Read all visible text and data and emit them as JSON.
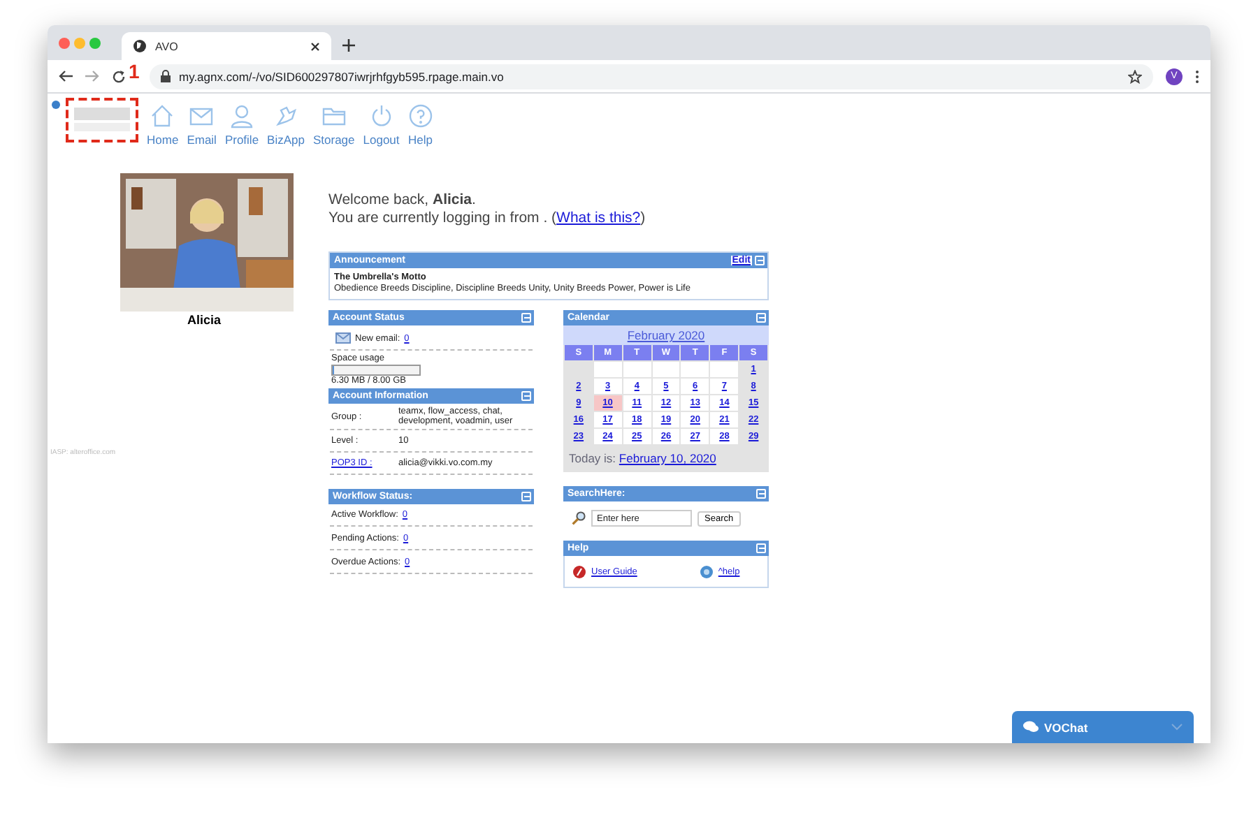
{
  "browser": {
    "tab_title": "AVO",
    "url": "my.agnx.com/-/vo/SID600297807iwrjrhfgyb595.rpage.main.vo",
    "avatar": "V"
  },
  "annotation": {
    "label": "1"
  },
  "nav": [
    {
      "label": "Home",
      "kind": "home"
    },
    {
      "label": "Email",
      "kind": "email"
    },
    {
      "label": "Profile",
      "kind": "profile"
    },
    {
      "label": "BizApp",
      "kind": "bizapp"
    },
    {
      "label": "Storage",
      "kind": "storage"
    },
    {
      "label": "Logout",
      "kind": "logout"
    },
    {
      "label": "Help",
      "kind": "help"
    }
  ],
  "profile": {
    "name": "Alicia"
  },
  "footer_note": "IASP: alteroffice.com",
  "welcome": {
    "greeting": "Welcome back, **Alicia**.",
    "login_line": "You are currently logging in from . (",
    "link": "What is this?",
    "after": ")"
  },
  "announcement": {
    "title": "Announcement",
    "edit": "Edit",
    "heading": "The Umbrella's Motto",
    "body": "Obedience Breeds Discipline, Discipline Breeds Unity, Unity Breeds Power, Power is Life"
  },
  "account_status": {
    "title": "Account Status",
    "new_email_label": "New email:",
    "new_email": "0",
    "space_label": "Space usage",
    "space": {
      "level": 0.01
    },
    "space_text": "6.30 MB / 8.00 GB"
  },
  "account_info": {
    "title": "Account Information",
    "rows": [
      {
        "label": "Group :",
        "value": "teamx, flow_access, chat, development, voadmin, user",
        "kind": "text"
      },
      {
        "label": "Level :",
        "value": "10",
        "kind": "text"
      },
      {
        "label": "POP3 ID :",
        "value": "alicia@vikki.vo.com.my",
        "kind": "link"
      }
    ]
  },
  "workflow": {
    "title": "Workflow Status:",
    "rows": [
      {
        "label": "Active Workflow:",
        "value": "0"
      },
      {
        "label": "Pending Actions:",
        "value": "0"
      },
      {
        "label": "Overdue Actions:",
        "value": "0"
      }
    ]
  },
  "calendar": {
    "title": "Calendar",
    "month": "February 2020",
    "weekdays": [
      "S",
      "M",
      "T",
      "W",
      "T",
      "F",
      "S"
    ],
    "weeks": [
      [
        {
          "kind": "blank"
        },
        {
          "kind": "blank"
        },
        {
          "kind": "blank"
        },
        {
          "kind": "blank"
        },
        {
          "kind": "blank"
        },
        {
          "kind": "blank"
        },
        {
          "kind": "day",
          "day": "1",
          "selected": false
        }
      ],
      [
        {
          "kind": "day",
          "day": "2",
          "selected": false
        },
        {
          "kind": "day",
          "day": "3",
          "selected": false
        },
        {
          "kind": "day",
          "day": "4",
          "selected": false
        },
        {
          "kind": "day",
          "day": "5",
          "selected": false
        },
        {
          "kind": "day",
          "day": "6",
          "selected": false
        },
        {
          "kind": "day",
          "day": "7",
          "selected": false
        },
        {
          "kind": "day",
          "day": "8",
          "selected": false
        }
      ],
      [
        {
          "kind": "day",
          "day": "9",
          "selected": false
        },
        {
          "kind": "day",
          "day": "10",
          "selected": true
        },
        {
          "kind": "day",
          "day": "11",
          "selected": false
        },
        {
          "kind": "day",
          "day": "12",
          "selected": false
        },
        {
          "kind": "day",
          "day": "13",
          "selected": false
        },
        {
          "kind": "day",
          "day": "14",
          "selected": false
        },
        {
          "kind": "day",
          "day": "15",
          "selected": false
        }
      ],
      [
        {
          "kind": "day",
          "day": "16",
          "selected": false
        },
        {
          "kind": "day",
          "day": "17",
          "selected": false
        },
        {
          "kind": "day",
          "day": "18",
          "selected": false
        },
        {
          "kind": "day",
          "day": "19",
          "selected": false
        },
        {
          "kind": "day",
          "day": "20",
          "selected": false
        },
        {
          "kind": "day",
          "day": "21",
          "selected": false
        },
        {
          "kind": "day",
          "day": "22",
          "selected": false
        }
      ],
      [
        {
          "kind": "day",
          "day": "23",
          "selected": false
        },
        {
          "kind": "day",
          "day": "24",
          "selected": false
        },
        {
          "kind": "day",
          "day": "25",
          "selected": false
        },
        {
          "kind": "day",
          "day": "26",
          "selected": false
        },
        {
          "kind": "day",
          "day": "27",
          "selected": false
        },
        {
          "kind": "day",
          "day": "28",
          "selected": false
        },
        {
          "kind": "day",
          "day": "29",
          "selected": false
        }
      ]
    ],
    "today_label": "Today is:",
    "today": "February 10, 2020"
  },
  "search": {
    "title": "SearchHere:",
    "placeholder": "Enter here",
    "button": "Search"
  },
  "help": {
    "title": "Help",
    "links": [
      {
        "label": "User Guide",
        "kind": "guide"
      },
      {
        "label": "^help",
        "kind": "info"
      }
    ]
  },
  "chat": {
    "label": "VOChat"
  }
}
